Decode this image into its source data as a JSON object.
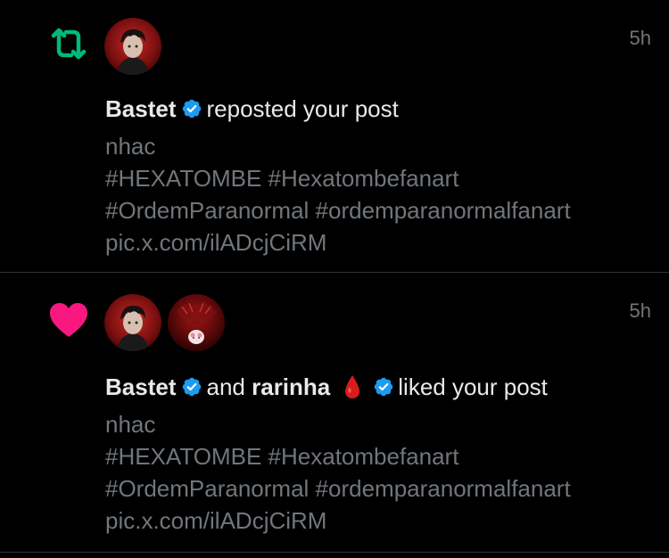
{
  "notifications": [
    {
      "type": "repost",
      "icon": "repost-icon",
      "icon_color": "#00ba7c",
      "timestamp": "5h",
      "avatars": [
        "avatar-bastet"
      ],
      "actor_1": "Bastet",
      "action_text": "reposted your post",
      "post_lines": [
        "nhac",
        "#HEXATOMBE #Hexatombefanart",
        "#OrdemParanormal #ordemparanormalfanart",
        "pic.x.com/ilADcjCiRM"
      ]
    },
    {
      "type": "like",
      "icon": "heart-icon",
      "icon_color": "#f91880",
      "timestamp": "5h",
      "avatars": [
        "avatar-bastet",
        "avatar-rarinha"
      ],
      "actor_1": "Bastet",
      "conjunction": "and",
      "actor_2": "rarinha",
      "action_text": "liked your post",
      "post_lines": [
        "nhac",
        "#HEXATOMBE #Hexatombefanart",
        "#OrdemParanormal #ordemparanormalfanart",
        "pic.x.com/ilADcjCiRM"
      ]
    }
  ],
  "colors": {
    "background": "#000000",
    "primary_text": "#e7e9ea",
    "secondary_text": "#71767b",
    "verified_blue": "#1d9bf0",
    "divider": "#2f3336"
  }
}
